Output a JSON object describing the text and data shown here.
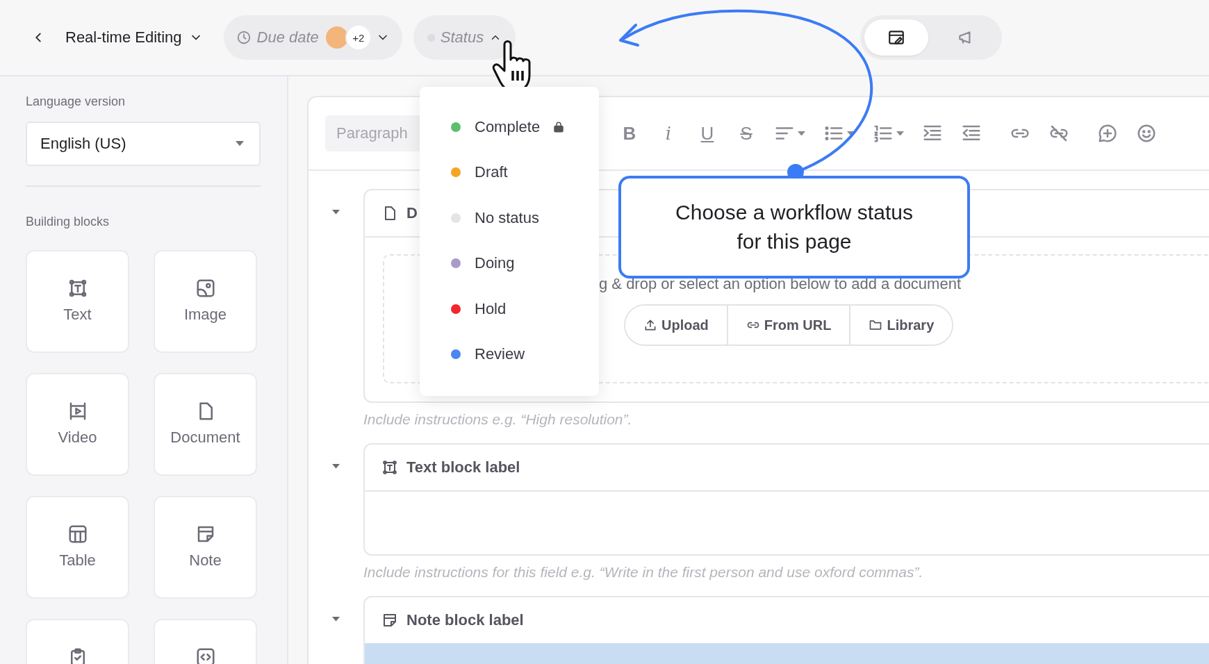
{
  "top_bar": {
    "title": "Real-time Editing",
    "due_date": {
      "label": "Due date",
      "extra_count": "+2"
    },
    "status": {
      "label": "Status",
      "expanded": true
    },
    "view_tabs": [
      {
        "kind": "editor",
        "selected": true
      },
      {
        "kind": "announce",
        "selected": false
      }
    ]
  },
  "sidebar": {
    "language_label": "Language version",
    "language_value": "English (US)",
    "blocks_label": "Building blocks",
    "blocks": [
      {
        "kind": "text",
        "label": "Text"
      },
      {
        "kind": "image",
        "label": "Image"
      },
      {
        "kind": "video",
        "label": "Video"
      },
      {
        "kind": "document",
        "label": "Document"
      },
      {
        "kind": "table",
        "label": "Table"
      },
      {
        "kind": "note",
        "label": "Note"
      },
      {
        "kind": "checklist"
      },
      {
        "kind": "code"
      }
    ]
  },
  "editor": {
    "style_placeholder": "Paragraph",
    "toolbar": [
      {
        "kind": "bold",
        "glyph": "B"
      },
      {
        "kind": "italic",
        "glyph": "i"
      },
      {
        "kind": "underline",
        "glyph": "U"
      },
      {
        "kind": "strike",
        "glyph": "S"
      },
      {
        "kind": "align"
      },
      {
        "kind": "bullets"
      },
      {
        "kind": "numbered"
      },
      {
        "kind": "indent"
      },
      {
        "kind": "outdent"
      },
      {
        "kind": "link"
      },
      {
        "kind": "unlink"
      },
      {
        "kind": "comment"
      },
      {
        "kind": "emoji"
      }
    ],
    "blocks": [
      {
        "kind": "document",
        "title": "D",
        "expanded": true,
        "dropzone_text": "g & drop or select an option below to add a document",
        "actions": [
          {
            "kind": "upload",
            "label": "Upload"
          },
          {
            "kind": "url",
            "label": "From URL"
          },
          {
            "kind": "library",
            "label": "Library"
          }
        ],
        "hint": "Include instructions e.g. “High resolution”."
      },
      {
        "kind": "text",
        "title": "Text block label",
        "expanded": true,
        "hint": "Include instructions for this field e.g. “Write in the first person and use oxford commas”."
      },
      {
        "kind": "note",
        "title": "Note block label",
        "expanded": true
      }
    ]
  },
  "status_menu": {
    "items": [
      {
        "label": "Complete",
        "color": "#5cbf6e",
        "locked": true,
        "selected": false
      },
      {
        "label": "Draft",
        "color": "#f5a524",
        "locked": false,
        "selected": false
      },
      {
        "label": "No status",
        "color": "#e4e4e7",
        "locked": false,
        "selected": false
      },
      {
        "label": "Doing",
        "color": "#a99ac9",
        "locked": false,
        "selected": false
      },
      {
        "label": "Hold",
        "color": "#f2262f",
        "locked": false,
        "selected": false
      },
      {
        "label": "Review",
        "color": "#4a86f0",
        "locked": false,
        "selected": false
      }
    ]
  },
  "callout": {
    "text": "Choose a workflow status for this page"
  }
}
